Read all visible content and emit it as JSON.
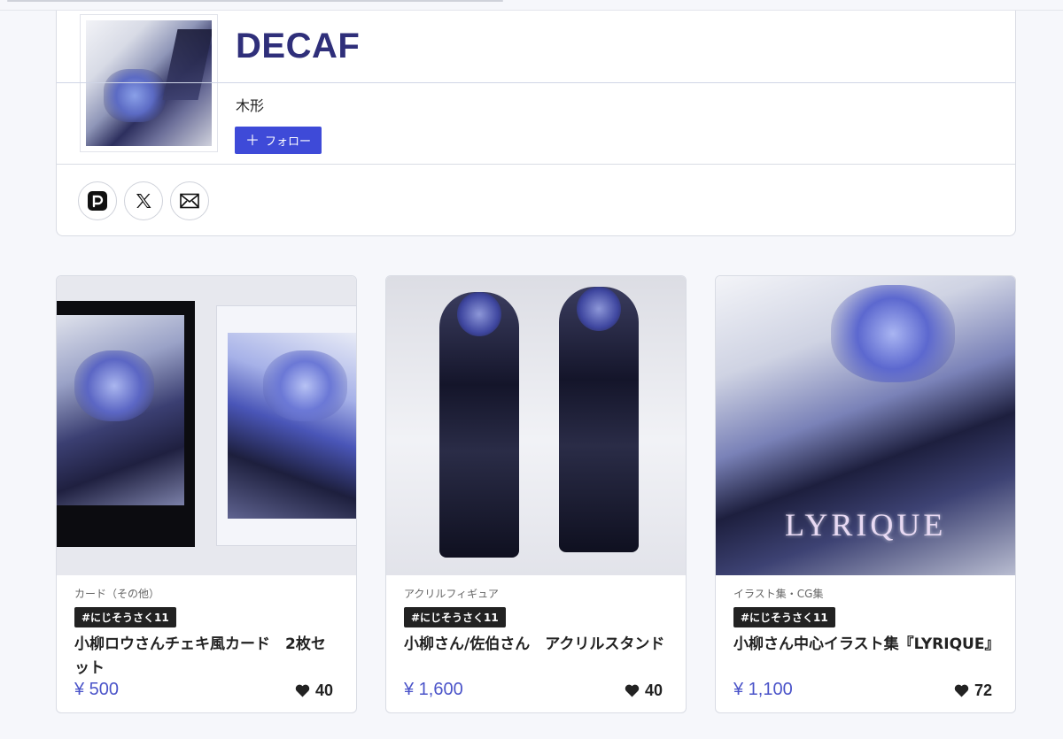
{
  "shop": {
    "name": "DECAF",
    "owner": "木形",
    "follow_label": "フォロー"
  },
  "social_links": [
    {
      "service": "pixiv",
      "icon": "pixiv-icon"
    },
    {
      "service": "x",
      "icon": "x-icon"
    },
    {
      "service": "mail",
      "icon": "mail-icon"
    }
  ],
  "items": [
    {
      "category": "カード（その他）",
      "tag": "#にじそうさく11",
      "title": "小柳ロウさんチェキ風カード　2枚セット",
      "price": "¥ 500",
      "likes": "40"
    },
    {
      "category": "アクリルフィギュア",
      "tag": "#にじそうさく11",
      "title": "小柳さん/佐伯さん　アクリルスタンド",
      "price": "¥ 1,600",
      "likes": "40"
    },
    {
      "category": "イラスト集・CG集",
      "tag": "#にじそうさく11",
      "title": "小柳さん中心イラスト集『LYRIQUE』",
      "price": "¥ 1,100",
      "likes": "72",
      "cover_text": "LYRIQUE"
    }
  ],
  "colors": {
    "accent": "#3e4ad8",
    "price": "#4b54c9",
    "title": "#2f2f7a"
  }
}
